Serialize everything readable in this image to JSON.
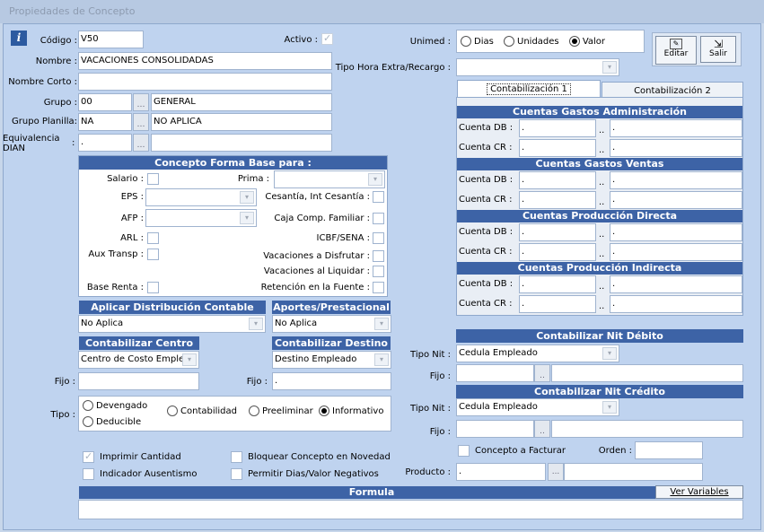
{
  "window_title": "Propiedades de Concepto",
  "info_icon": "i",
  "left": {
    "codigo_label": "Código :",
    "codigo_value": "V50",
    "activo_label": "Activo :",
    "nombre_label": "Nombre :",
    "nombre_value": "VACACIONES CONSOLIDADAS",
    "nombre_corto_label": "Nombre Corto :",
    "grupo_label": "Grupo :",
    "grupo_code": "00",
    "grupo_name": "GENERAL",
    "grupo_planilla_label": "Grupo Planilla:",
    "grupo_planilla_code": "NA",
    "grupo_planilla_name": "NO APLICA",
    "equivalencia_label": "Equivalencia DIAN",
    "equivalencia_colon": ":",
    "equivalencia_value": "."
  },
  "unimed": {
    "label": "Unimed :",
    "options": [
      "Dias",
      "Unidades",
      "Valor"
    ],
    "selected": "Valor"
  },
  "tipo_hora_label": "Tipo Hora Extra/Recargo :",
  "toolbar": {
    "editar_label": "Editar",
    "salir_label": "Salir"
  },
  "tabs": {
    "tab1": "Contabilización 1",
    "tab2": "Contabilización 2"
  },
  "cuentas": {
    "sections": [
      {
        "title": "Cuentas Gastos Administración"
      },
      {
        "title": "Cuentas Gastos Ventas"
      },
      {
        "title": "Cuentas Producción Directa"
      },
      {
        "title": "Cuentas Producción Indirecta"
      }
    ],
    "db_label": "Cuenta DB :",
    "cr_label": "Cuenta CR :",
    "value": ".",
    "dots": ".."
  },
  "base": {
    "title": "Concepto Forma Base para :",
    "salario": "Salario :",
    "prima": "Prima :",
    "eps": "EPS :",
    "cesantia": "Cesantía, Int Cesantía :",
    "afp": "AFP :",
    "caja": "Caja Comp. Familiar :",
    "arl": "ARL :",
    "icbf": "ICBF/SENA :",
    "aux": "Aux Transp :",
    "vac_disfrutar": "Vacaciones a Disfrutar :",
    "vac_liquidar": "Vacaciones al Liquidar :",
    "base_renta": "Base Renta :",
    "retencion": "Retención en la Fuente :"
  },
  "distribucion": {
    "title": "Aplicar Distribución Contable",
    "value": "No Aplica"
  },
  "aportes": {
    "title": "Aportes/Prestacional",
    "value": "No Aplica"
  },
  "centro": {
    "title": "Contabilizar Centro",
    "value": "Centro de Costo Emple",
    "fijo_label": "Fijo :"
  },
  "destino": {
    "title": "Contabilizar Destino",
    "value": "Destino Empleado",
    "fijo_label": "Fijo :",
    "fijo_value": "."
  },
  "tipo": {
    "label": "Tipo :",
    "options": [
      "Devengado",
      "Deducible",
      "Contabilidad",
      "Preeliminar",
      "Informativo"
    ],
    "selected": "Informativo"
  },
  "checks": {
    "imprimir": "Imprimir Cantidad",
    "ausentismo": "Indicador Ausentismo",
    "bloquear": "Bloquear Concepto en Novedad",
    "permitir": "Permitir Dias/Valor Negativos"
  },
  "nit_debito": {
    "title": "Contabilizar Nit Débito",
    "tipo_label": "Tipo Nit :",
    "tipo_value": "Cedula Empleado",
    "fijo_label": "Fijo :"
  },
  "nit_credito": {
    "title": "Contabilizar Nit Crédito",
    "tipo_label": "Tipo Nit :",
    "tipo_value": "Cedula Empleado",
    "fijo_label": "Fijo :"
  },
  "facturar": {
    "label": "Concepto a Facturar",
    "orden_label": "Orden :"
  },
  "producto": {
    "label": "Producto :",
    "value": ".",
    "dots": "..."
  },
  "formula": {
    "title": "Formula",
    "ver_variables": "Ver Variables"
  },
  "colors": {
    "header_blue": "#3d63a6",
    "panel_bg": "#bfd3ef"
  }
}
